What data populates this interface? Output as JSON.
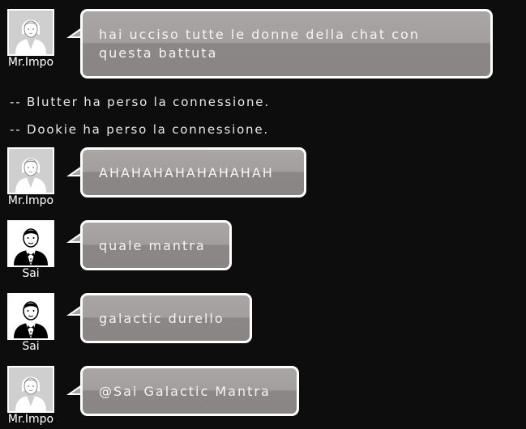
{
  "messages": [
    {
      "username": "Mr.Impo",
      "avatar": "woman-icon",
      "text_line1": "hai ucciso tutte le donne della chat con",
      "text_line2": "questa battuta"
    },
    {
      "username": "Mr.Impo",
      "avatar": "woman-icon",
      "text": "AHAHAHAHAHAHAHAH"
    },
    {
      "username": "Sai",
      "avatar": "man-tuxedo-icon",
      "text": "quale mantra"
    },
    {
      "username": "Sai",
      "avatar": "man-tuxedo-icon",
      "text": "galactic durello"
    },
    {
      "username": "Mr.Impo",
      "avatar": "woman-icon",
      "text": "@Sai Galactic Mantra"
    }
  ],
  "system_messages": [
    "-- Blutter ha perso la connessione.",
    "-- Dookie ha perso la connessione."
  ],
  "colors": {
    "background": "#0d0d0d",
    "bubble_top": "#aba6a6",
    "bubble_bottom": "#8a8686",
    "bubble_border": "#ffffff",
    "text": "#f4f4f4"
  }
}
